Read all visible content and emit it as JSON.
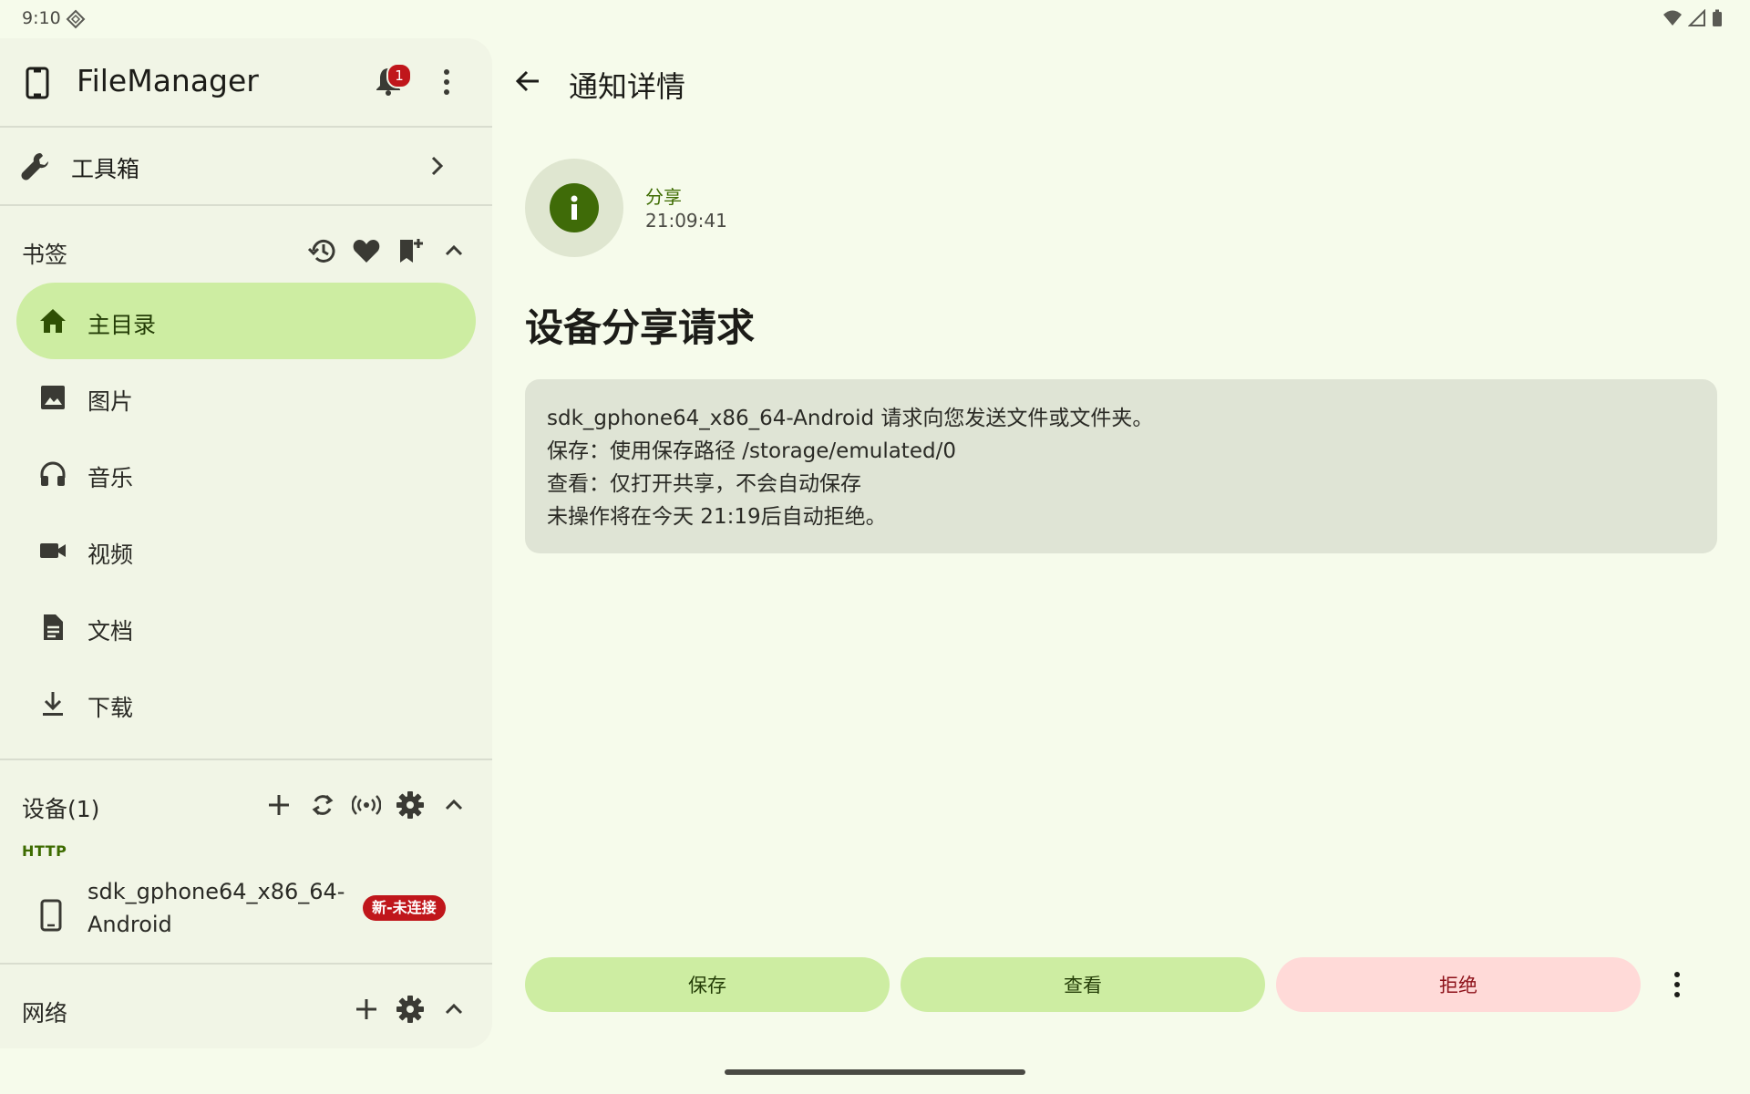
{
  "status_bar": {
    "time": "9:10"
  },
  "drawer": {
    "app_title": "FileManager",
    "notification_count": "1",
    "toolbox_label": "工具箱",
    "bookmarks": {
      "title": "书签",
      "items": [
        {
          "label": "主目录",
          "icon": "home-icon",
          "active": true
        },
        {
          "label": "图片",
          "icon": "image-icon"
        },
        {
          "label": "音乐",
          "icon": "headphones-icon"
        },
        {
          "label": "视频",
          "icon": "videocam-icon"
        },
        {
          "label": "文档",
          "icon": "document-icon"
        },
        {
          "label": "下载",
          "icon": "download-icon"
        }
      ]
    },
    "devices": {
      "title": "设备(1)",
      "protocol_label": "HTTP",
      "device_name": "sdk_gphone64_x86_64-Android",
      "device_badge": "新-未连接"
    },
    "network": {
      "title": "网络"
    }
  },
  "detail": {
    "page_title": "通知详情",
    "notif_type": "分享",
    "notif_time": "21:09:41",
    "heading": "设备分享请求",
    "message_lines": [
      "sdk_gphone64_x86_64-Android 请求向您发送文件或文件夹。",
      "保存：使用保存路径 /storage/emulated/0",
      "查看：仅打开共享，不会自动保存",
      "未操作将在今天 21:19后自动拒绝。"
    ],
    "buttons": {
      "save": "保存",
      "view": "查看",
      "reject": "拒绝"
    }
  },
  "colors": {
    "background": "#f6fbeb",
    "drawer": "#f1f5e6",
    "accent_container": "#cdeda2",
    "primary": "#3f6b08",
    "error_container": "#ffdad8",
    "badge_red": "#c0161b"
  }
}
